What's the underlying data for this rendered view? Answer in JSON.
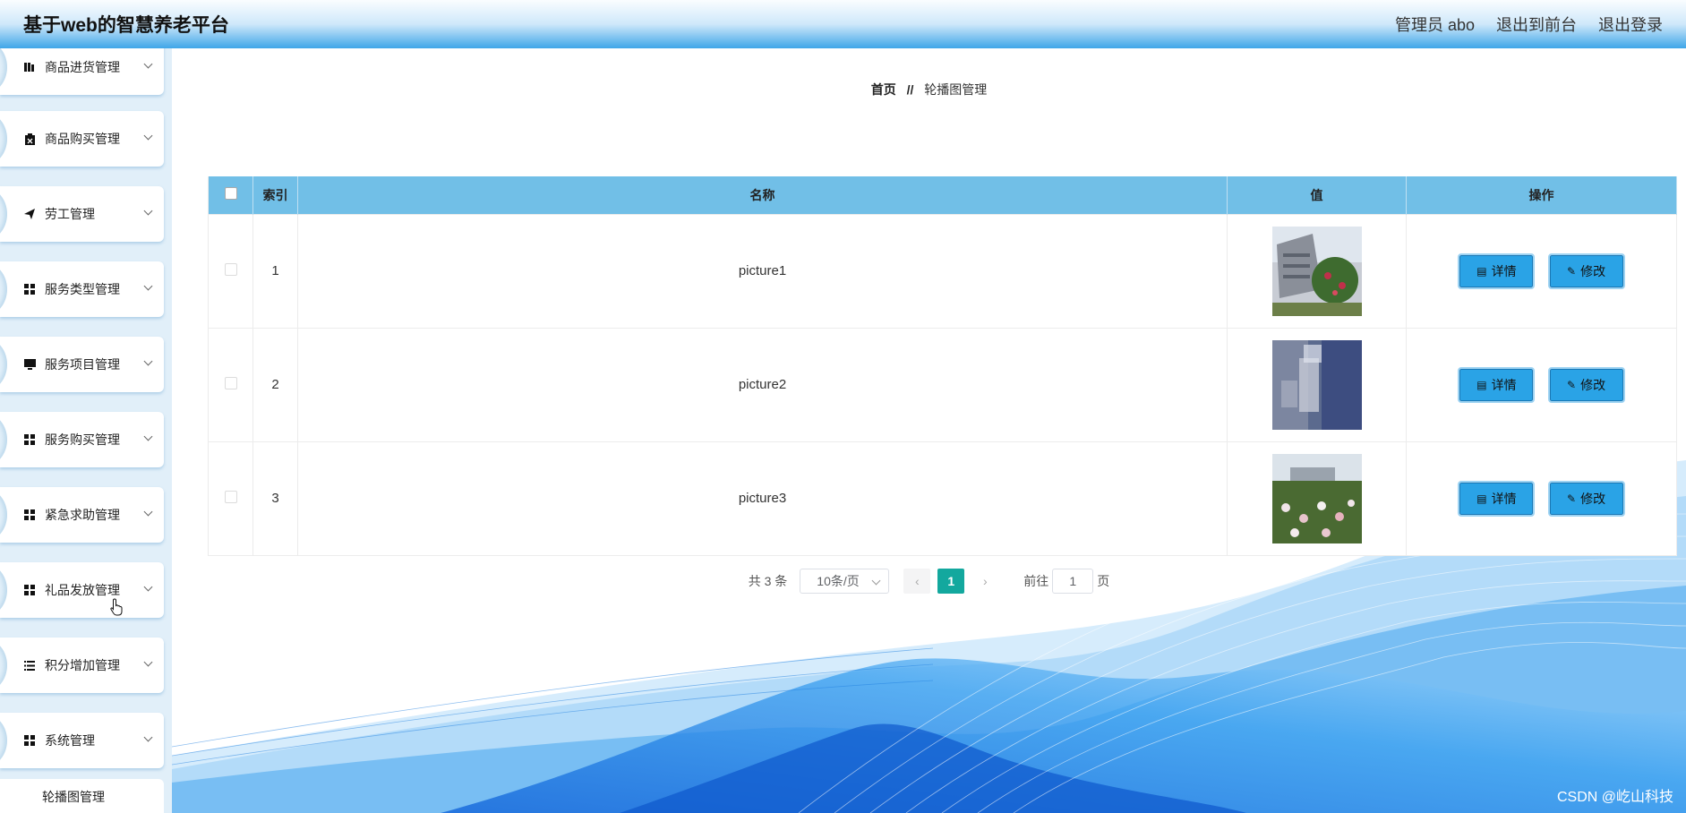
{
  "header": {
    "title": "基于web的智慧养老平台",
    "admin_label": "管理员 abo",
    "back_to_front": "退出到前台",
    "logout": "退出登录"
  },
  "sidebar": {
    "items": [
      {
        "label": "商品进货管理",
        "icon": "bar-chart-icon"
      },
      {
        "label": "商品购买管理",
        "icon": "clipboard-icon"
      },
      {
        "label": "劳工管理",
        "icon": "send-icon"
      },
      {
        "label": "服务类型管理",
        "icon": "grid-icon"
      },
      {
        "label": "服务项目管理",
        "icon": "monitor-icon"
      },
      {
        "label": "服务购买管理",
        "icon": "grid-icon"
      },
      {
        "label": "紧急求助管理",
        "icon": "grid-icon"
      },
      {
        "label": "礼品发放管理",
        "icon": "grid-icon"
      },
      {
        "label": "积分增加管理",
        "icon": "list-icon"
      },
      {
        "label": "系统管理",
        "icon": "grid-icon"
      }
    ],
    "sub_item": "轮播图管理"
  },
  "breadcrumb": {
    "home": "首页",
    "separator": "//",
    "current": "轮播图管理"
  },
  "table": {
    "headers": {
      "index": "索引",
      "name": "名称",
      "value": "值",
      "action": "操作"
    },
    "rows": [
      {
        "index": "1",
        "name": "picture1",
        "detail": "详情",
        "edit": "修改"
      },
      {
        "index": "2",
        "name": "picture2",
        "detail": "详情",
        "edit": "修改"
      },
      {
        "index": "3",
        "name": "picture3",
        "detail": "详情",
        "edit": "修改"
      }
    ]
  },
  "pagination": {
    "total": "共 3 条",
    "page_size": "10条/页",
    "prev": "‹",
    "current_page": "1",
    "next": "›",
    "goto_label": "前往",
    "goto_value": "1",
    "page_unit": "页"
  },
  "watermark": "CSDN @屹山科技",
  "colors": {
    "header_accent": "#3fa6e8",
    "table_header": "#71bfe7",
    "button": "#2aa3e6",
    "active_page": "#13a89e"
  }
}
